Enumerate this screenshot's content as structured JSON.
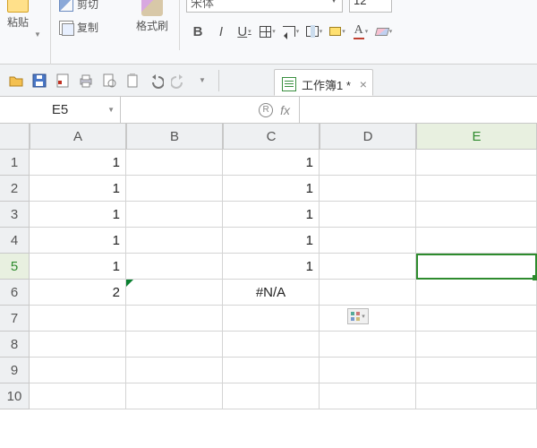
{
  "ribbon": {
    "paste_label": "粘贴",
    "cut_label": "剪切",
    "copy_label": "复制",
    "format_painter_label": "格式刷",
    "font_name": "宋体",
    "font_size": "12",
    "bold_glyph": "B",
    "italic_glyph": "I",
    "underline_glyph": "U",
    "fontcolor_glyph": "A"
  },
  "qat": {
    "doc_tab_title": "工作簿1 *"
  },
  "formula_bar": {
    "name_box": "E5",
    "fx_label": "fx",
    "formula_value": ""
  },
  "grid": {
    "col_headers": [
      "A",
      "B",
      "C",
      "D",
      "E"
    ],
    "row_headers": [
      "1",
      "2",
      "3",
      "4",
      "5",
      "6",
      "7",
      "8",
      "9",
      "10"
    ],
    "cells": {
      "A1": "1",
      "C1": "1",
      "A2": "1",
      "C2": "1",
      "A3": "1",
      "C3": "1",
      "A4": "1",
      "C4": "1",
      "A5": "1",
      "C5": "1",
      "A6": "2",
      "C6": "#N/A"
    },
    "active_cell": "E5"
  }
}
